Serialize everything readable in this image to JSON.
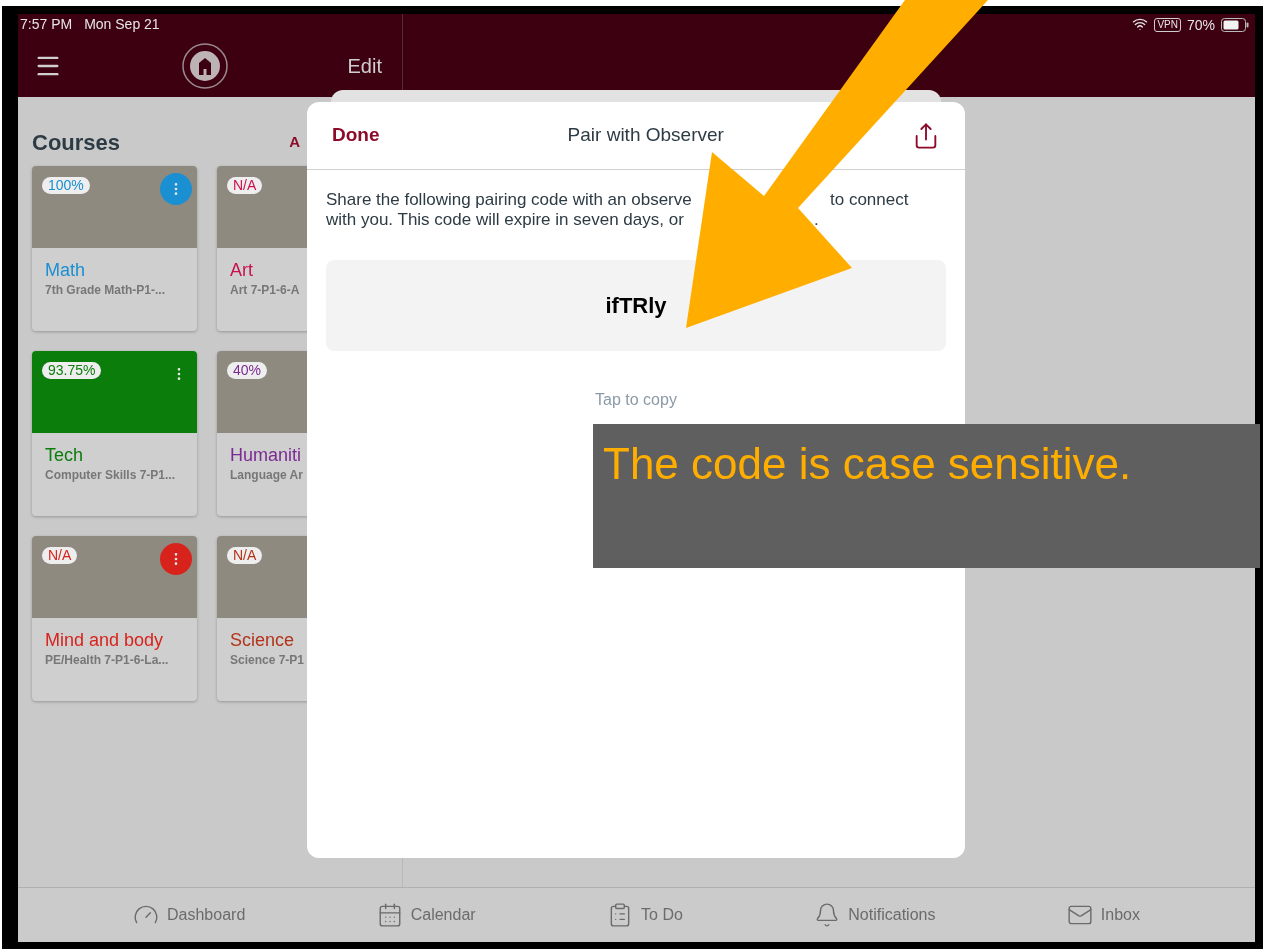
{
  "status_bar": {
    "time": "7:57 PM",
    "date": "Mon Sep 21",
    "vpn": "VPN",
    "battery": "70%"
  },
  "nav": {
    "edit": "Edit"
  },
  "courses": {
    "title": "Courses",
    "link": "A",
    "items": [
      {
        "name": "Math",
        "subtitle": "7th Grade Math-P1-...",
        "grade": "100%",
        "color": "#1a8fd1",
        "kind": "photo",
        "menu": true
      },
      {
        "name": "Art",
        "subtitle": "Art 7-P1-6-A",
        "grade": "N/A",
        "color": "#c8124f",
        "kind": "photo"
      },
      {
        "name": "Tech",
        "subtitle": "Computer Skills 7-P1...",
        "grade": "93.75%",
        "color": "#0b7d0b",
        "kind": "solid",
        "menu": true
      },
      {
        "name": "Humaniti",
        "subtitle": "Language Ar",
        "grade": "40%",
        "color": "#7b2a94",
        "kind": "photo"
      },
      {
        "name": "Mind and body",
        "subtitle": "PE/Health 7-P1-6-La...",
        "grade": "N/A",
        "color": "#d8231c",
        "kind": "photo",
        "menu": true
      },
      {
        "name": "Science",
        "subtitle": "Science 7-P1",
        "grade": "N/A",
        "color": "#b3341a",
        "kind": "photo"
      }
    ]
  },
  "dialog": {
    "done": "Done",
    "title": "Pair with Observer",
    "message": [
      "Share the following pairing code with an observe",
      "to connect",
      "with you. This code will expire in seven days, or",
      "."
    ],
    "code": "ifTRly",
    "hint": "Tap to copy"
  },
  "tab_bar": [
    {
      "label": "Dashboard",
      "kind": "gauge"
    },
    {
      "label": "Calendar",
      "kind": "calendar"
    },
    {
      "label": "To Do",
      "kind": "todo"
    },
    {
      "label": "Notifications",
      "kind": "bell"
    },
    {
      "label": "Inbox",
      "kind": "mail"
    }
  ],
  "callout": {
    "text": "The code is case sensitive."
  }
}
